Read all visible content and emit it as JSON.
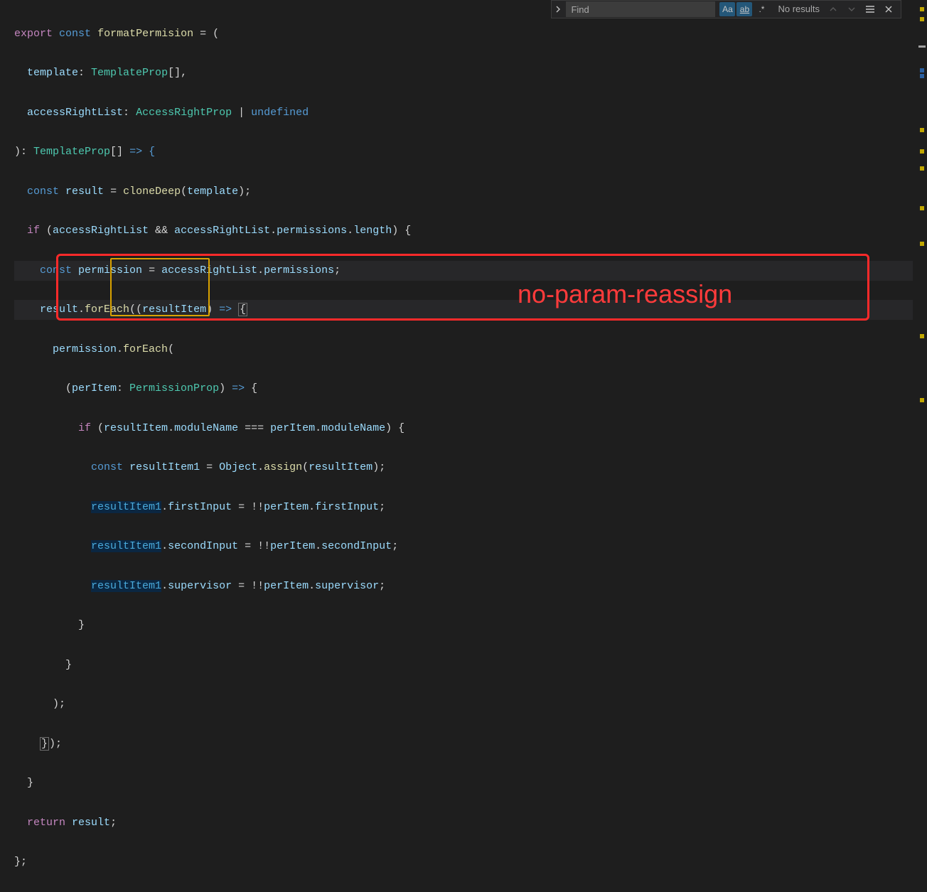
{
  "find": {
    "placeholder": "Find",
    "match_case": "Aa",
    "match_word": "ab",
    "regex": ".*",
    "results": "No results"
  },
  "annotation": {
    "label": "no-param-reassign"
  },
  "code": {
    "l1_export": "export",
    "l1_const": "const",
    "l1_fn": "formatPermision",
    "l1_eqparen": " = (",
    "l2_template": "template",
    "l2_type": "TemplateProp",
    "l2_brackets": "[],",
    "l3_arl": "accessRightList",
    "l3_type": "AccessRightProp",
    "l3_undef": "undefined",
    "l4_ret": "TemplateProp",
    "l4_brackets": "[]",
    "l4_arrow": " => {",
    "l5_const": "const",
    "l5_result": "result",
    "l5_clone": "cloneDeep",
    "l5_template": "template",
    "l6_if": "if",
    "l6_arl": "accessRightList",
    "l6_perm": "permissions",
    "l6_len": "length",
    "l7_const": "const",
    "l7_perm": "permission",
    "l7_arl": "accessRightList",
    "l7_perms": "permissions",
    "l8_result": "result",
    "l8_foreach": "forEach",
    "l8_ri": "resultItem",
    "l9_perm": "permission",
    "l9_foreach": "forEach",
    "l10_peritem": "perItem",
    "l10_type": "PermissionProp",
    "l11_if": "if",
    "l11_ri": "resultItem",
    "l11_mod": "moduleName",
    "l11_pi": "perItem",
    "l12_const": "const",
    "l12_ri1": "resultItem1",
    "l12_obj": "Object",
    "l12_assign": "assign",
    "l12_ri": "resultItem",
    "l13_ri1": "resultItem1",
    "l13_fi": "firstInput",
    "l13_pi": "perItem",
    "l14_ri1": "resultItem1",
    "l14_si": "secondInput",
    "l14_pi": "perItem",
    "l15_ri1": "resultItem1",
    "l15_sup": "supervisor",
    "l15_pi": "perItem",
    "l20_return": "return",
    "l20_result": "result"
  }
}
